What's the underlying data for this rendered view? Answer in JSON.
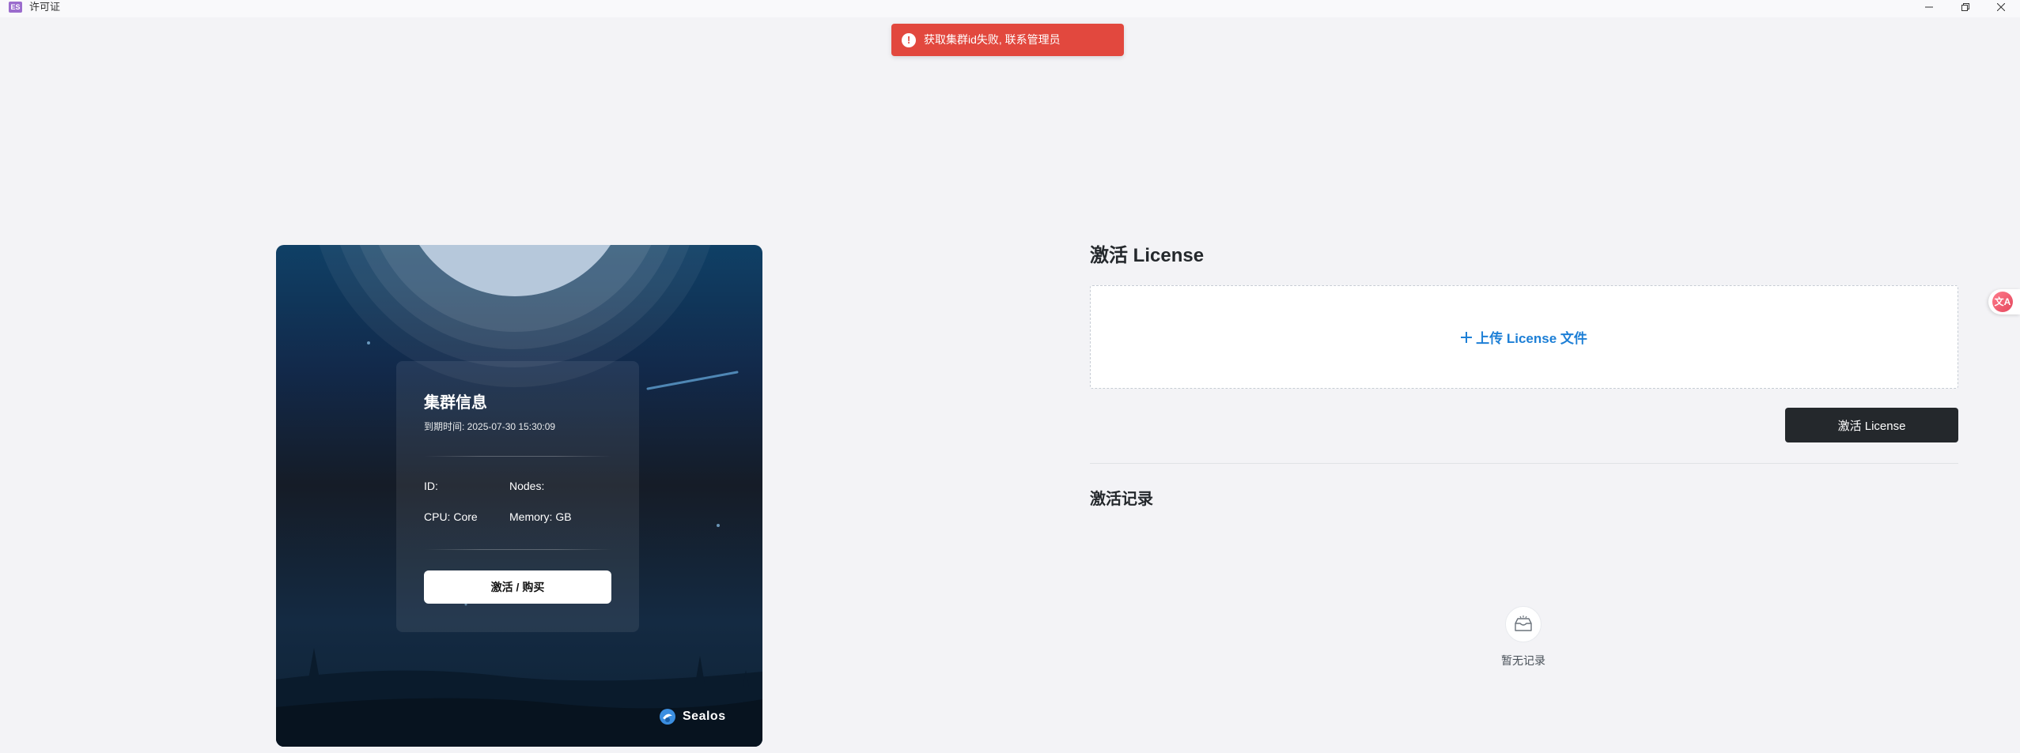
{
  "window": {
    "app_icon_text": "ES",
    "title": "许可证"
  },
  "toast": {
    "icon": "exclamation-icon",
    "message": "获取集群id失败, 联系管理员",
    "color": "#e2483e"
  },
  "cluster_card": {
    "title": "集群信息",
    "expiry": "到期时间: 2025-07-30 15:30:09",
    "fields": {
      "id": "ID:",
      "nodes": "Nodes:",
      "cpu": "CPU: Core",
      "memory": "Memory: GB"
    },
    "button_label": "激活 / 购买",
    "brand_name": "Sealos"
  },
  "activate": {
    "heading": "激活 License",
    "upload_label": "上传 License 文件",
    "button_label": "激活 License",
    "accent_color": "#1d7fd6"
  },
  "records": {
    "heading": "激活记录",
    "empty_text": "暂无记录"
  },
  "translate_widget": {
    "icon": "translate-icon",
    "glyph": "文A"
  }
}
